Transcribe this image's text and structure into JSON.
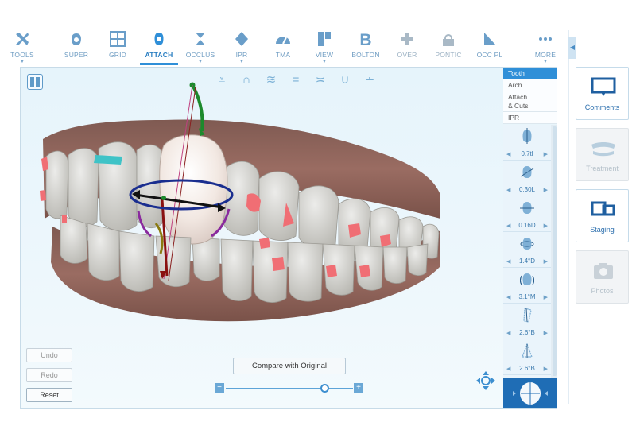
{
  "toolbar": {
    "tools": [
      {
        "label": "TOOLS",
        "icon": "tools-icon"
      },
      {
        "label": "SUPER",
        "icon": "superimpose-icon"
      },
      {
        "label": "GRID",
        "icon": "grid-icon"
      },
      {
        "label": "ATTACH",
        "icon": "attachment-icon",
        "active": true
      },
      {
        "label": "OCCLUS",
        "icon": "occlusion-icon"
      },
      {
        "label": "IPR",
        "icon": "ipr-icon"
      },
      {
        "label": "TMA",
        "icon": "tma-icon"
      },
      {
        "label": "VIEW",
        "icon": "view-icon"
      },
      {
        "label": "BOLTON",
        "icon": "bolton-icon"
      },
      {
        "label": "OVER",
        "icon": "overlay-icon"
      },
      {
        "label": "PONTIC",
        "icon": "pontic-icon"
      },
      {
        "label": "OCC PL",
        "icon": "occlusal-plane-icon"
      },
      {
        "label": "MORE",
        "icon": "more-icon"
      }
    ]
  },
  "tabs": [
    "Tooth",
    "Arch",
    "Attach\n& Cuts",
    "IPR"
  ],
  "params": [
    {
      "value": "0.7tl",
      "icon": "extrusion-icon"
    },
    {
      "value": "0.30L",
      "icon": "translation-icon"
    },
    {
      "value": "0.16D",
      "icon": "mesial-distal-icon"
    },
    {
      "value": "1.4°D",
      "icon": "rotation-icon"
    },
    {
      "value": "3.1°M",
      "icon": "angulation-icon"
    },
    {
      "value": "2.6°B",
      "icon": "inclination-icon"
    },
    {
      "value": "2.6°B",
      "icon": "torque-icon"
    }
  ],
  "controls": {
    "undo": "Undo",
    "redo": "Redo",
    "reset": "Reset",
    "compare": "Compare with Original",
    "slider_min": "−",
    "slider_max": "+"
  },
  "side_panel": {
    "comments": "Comments",
    "treatment": "Treatment",
    "staging": "Staging",
    "photos": "Photos"
  },
  "colors": {
    "accent": "#2f8fd8",
    "gum": "#8a5f55",
    "tooth": "#d8d8d2",
    "attachment": "#f06e74"
  }
}
